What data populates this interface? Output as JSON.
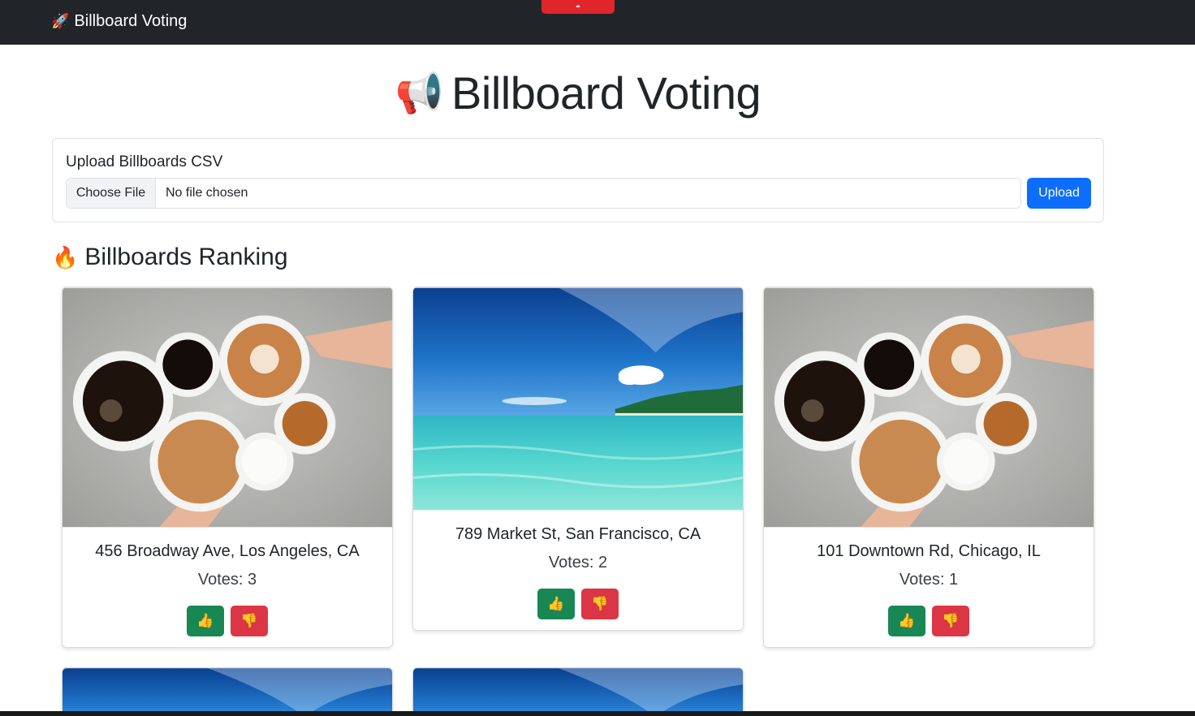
{
  "navbar": {
    "brand_icon": "rocket-icon",
    "brand": "Billboard Voting",
    "rec_icon": "recording-icon"
  },
  "header": {
    "icon": "megaphone-icon",
    "title": "Billboard Voting"
  },
  "upload": {
    "label": "Upload Billboards CSV",
    "choose_file": "Choose File",
    "file_status": "No file chosen",
    "button": "Upload"
  },
  "ranking": {
    "icon": "fire-icon",
    "title": "Billboards Ranking",
    "cards": [
      {
        "image": "coffee-cups-image",
        "address": "456 Broadway Ave, Los Angeles, CA",
        "votes": "Votes: 3"
      },
      {
        "image": "tropical-beach-image",
        "address": "789 Market St, San Francisco, CA",
        "votes": "Votes: 2"
      },
      {
        "image": "coffee-cups-image",
        "address": "101 Downtown Rd, Chicago, IL",
        "votes": "Votes: 1"
      }
    ]
  },
  "colors": {
    "navbar": "#212529",
    "primary": "#0d6efd",
    "success": "#198754",
    "danger": "#dc3545"
  }
}
